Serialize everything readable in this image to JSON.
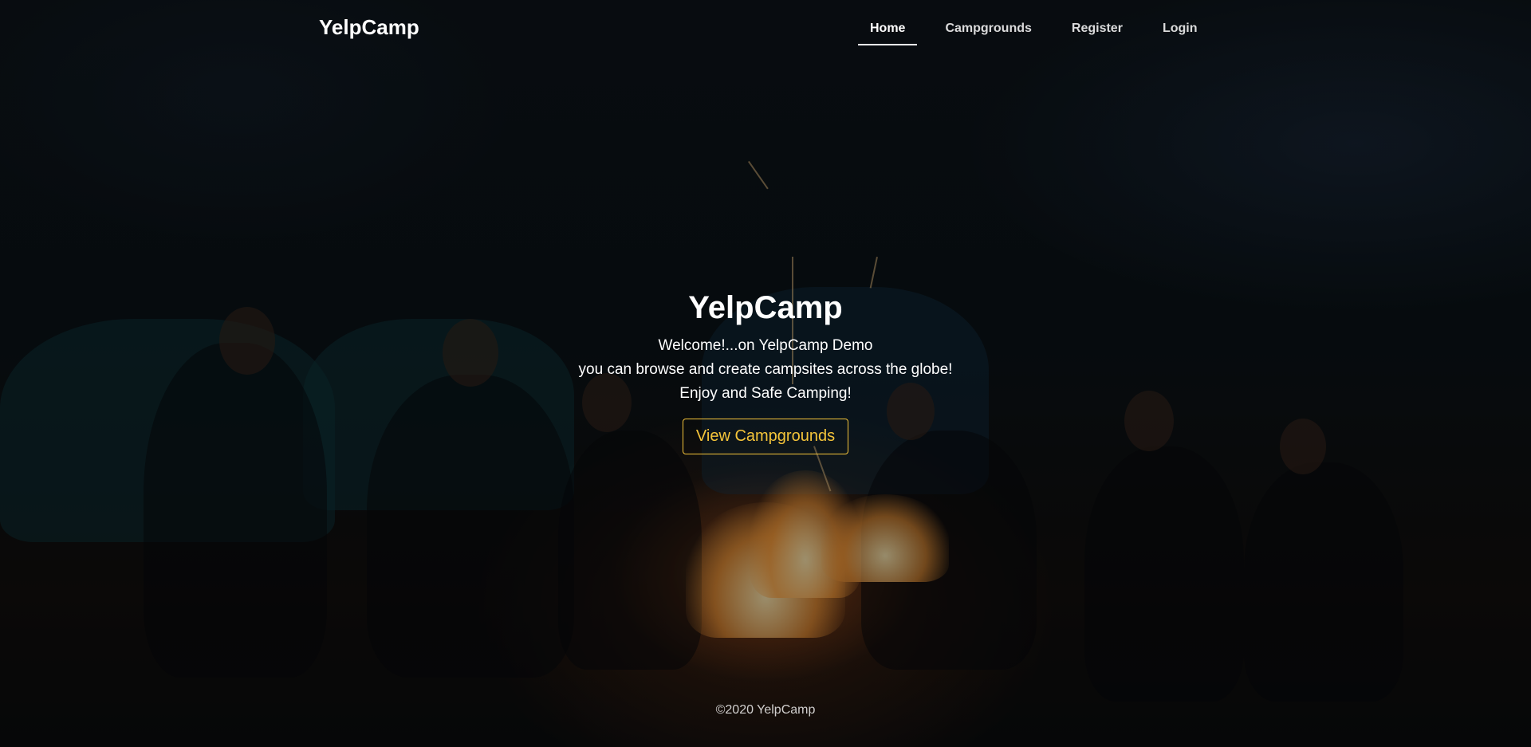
{
  "brand": "YelpCamp",
  "nav": {
    "links": [
      {
        "label": "Home",
        "active": true
      },
      {
        "label": "Campgrounds",
        "active": false
      },
      {
        "label": "Register",
        "active": false
      },
      {
        "label": "Login",
        "active": false
      }
    ]
  },
  "hero": {
    "title": "YelpCamp",
    "lines": [
      "Welcome!...on YelpCamp Demo",
      "you can browse and create campsites across the globe!",
      "Enjoy and Safe Camping!"
    ],
    "button_label": "View Campgrounds"
  },
  "footer": {
    "text": "©2020 YelpCamp"
  },
  "colors": {
    "accent": "#f5c43a",
    "text": "#ffffff"
  }
}
